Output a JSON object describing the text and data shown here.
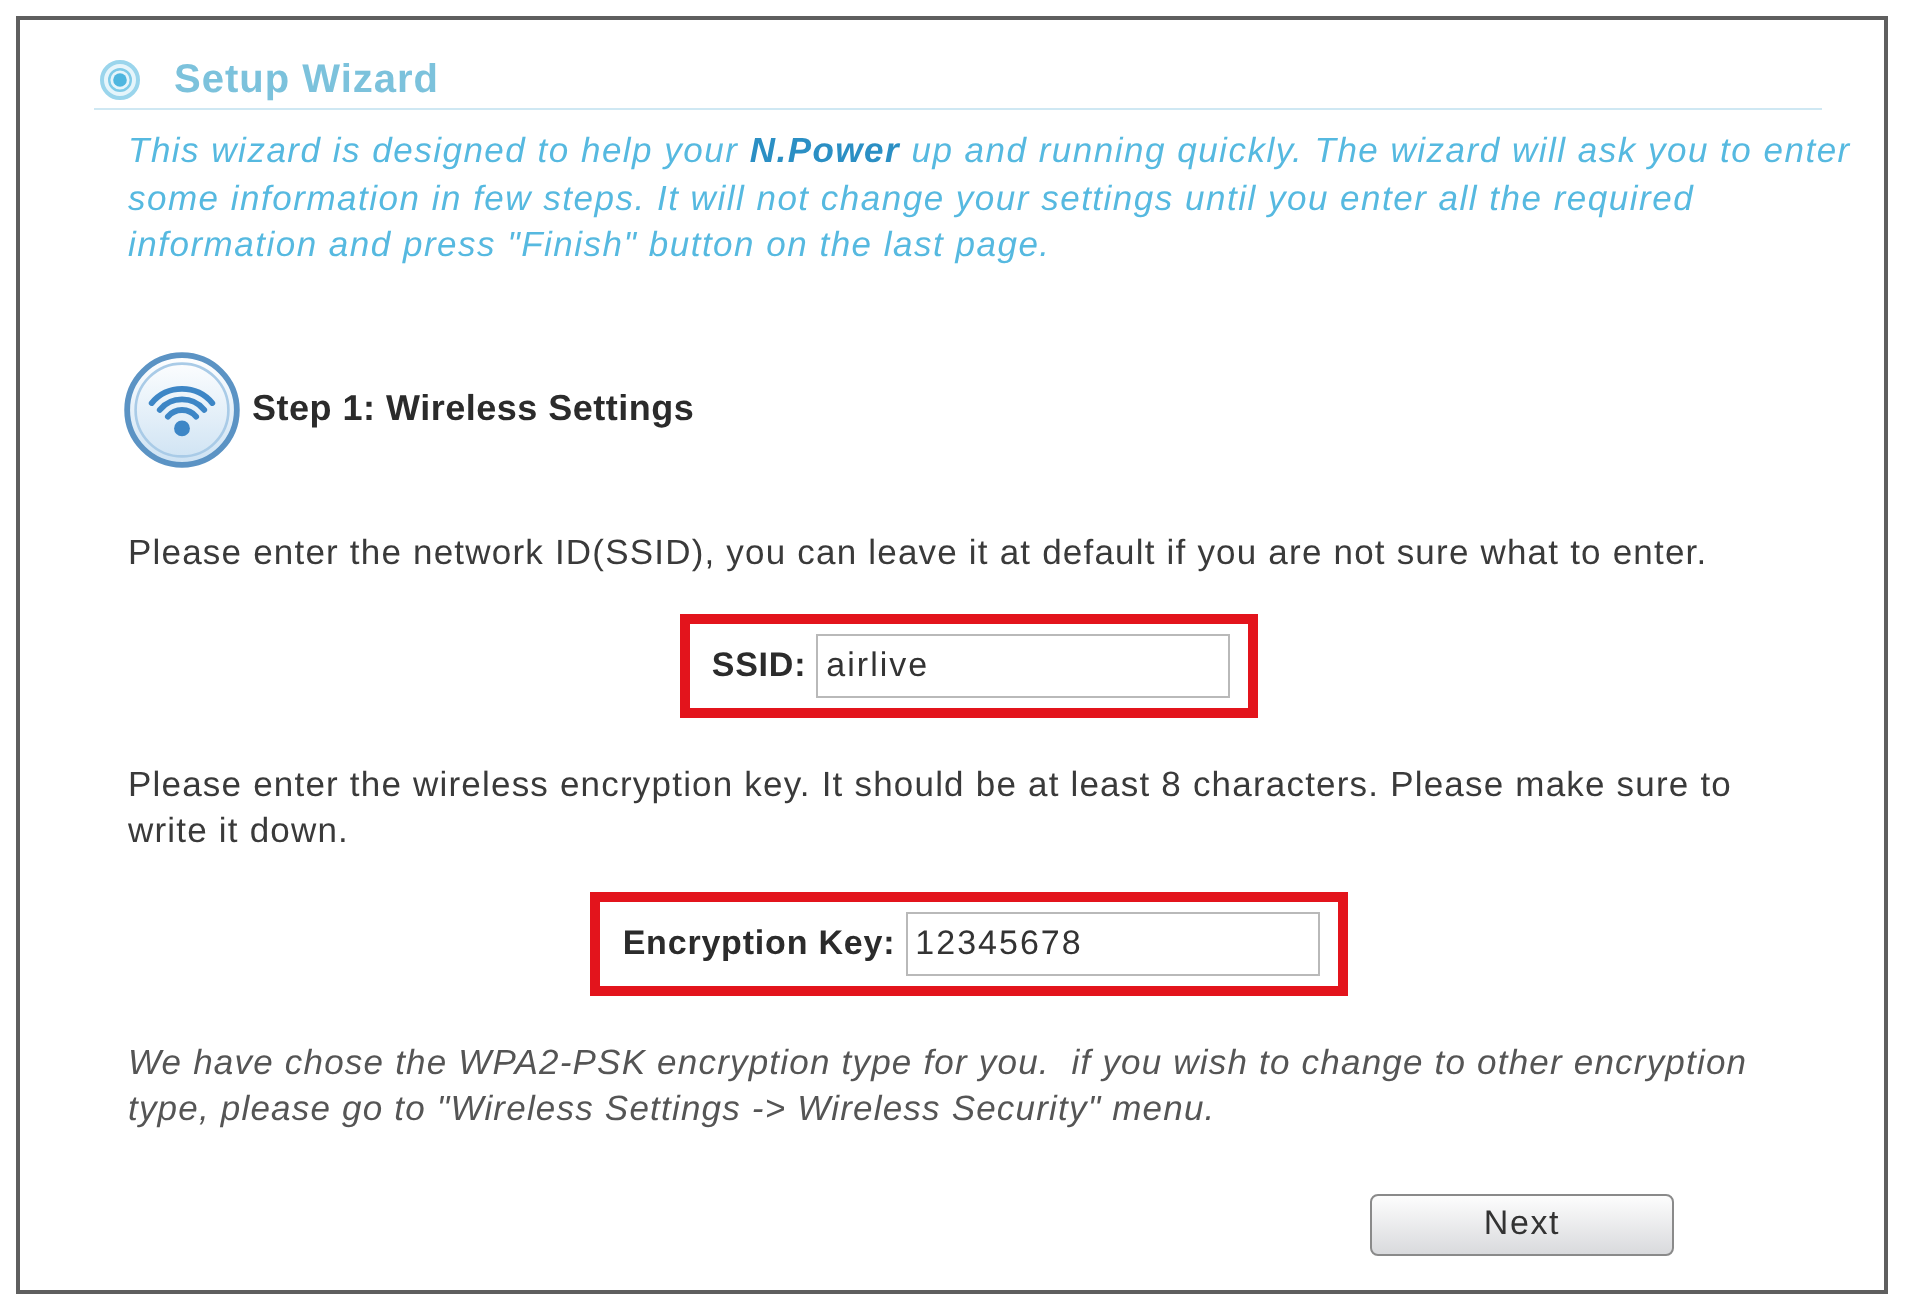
{
  "wizard": {
    "title": "Setup Wizard",
    "intro_lines": [
      "This wizard is designed to help your **N.Power** up and running quickly. The wizard will ask you to enter",
      "some information in few steps. It will not change your settings until you enter all the required",
      "information and press \"Finish\" button on the last page."
    ]
  },
  "step": {
    "title": "Step 1: Wireless Settings"
  },
  "content": [
    {
      "kind": "paragraph",
      "lines": [
        "Please enter the network ID(SSID), you can leave it at default if you are not sure what to enter."
      ]
    },
    {
      "kind": "field",
      "label": "SSID:",
      "value": "airlive",
      "highlighted": true
    },
    {
      "kind": "paragraph",
      "lines": [
        "Please enter the wireless encryption key. It should be at least 8 characters. Please make sure to",
        "write it down."
      ]
    },
    {
      "kind": "field",
      "label": "Encryption Key:",
      "value": "12345678",
      "highlighted": true
    },
    {
      "kind": "note",
      "lines": [
        "We have chose the WPA2-PSK encryption type for you.  if you wish to change to other encryption",
        "type, please go to \"Wireless Settings -> Wireless Security\" menu."
      ]
    }
  ],
  "buttons": [
    {
      "label": "Next"
    }
  ]
}
